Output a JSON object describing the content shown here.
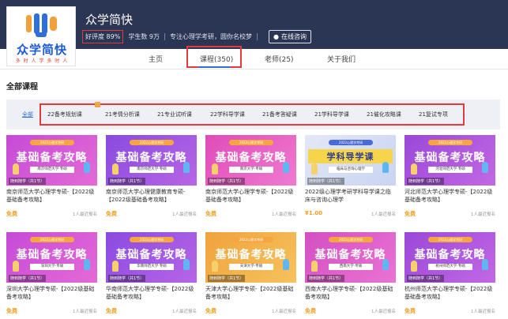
{
  "shop": {
    "name": "众学简快",
    "logo_text": "众学简快",
    "logo_sub": "多 时 人 学 多 时 人",
    "rating": "好评度 89%",
    "students": "学生数 9万",
    "tagline": "专注心理学考研，圆你名校梦",
    "follow_label": "在线咨询"
  },
  "nav": {
    "items": [
      "主页",
      "课程(350)",
      "老师(25)",
      "关于我们"
    ]
  },
  "section_title": "全部课程",
  "filter": {
    "all_label": "全部",
    "categories": [
      "22备考规划课",
      "21考情分析课",
      "21专业试听课",
      "22学科导学课",
      "21备考答疑课",
      "21学科导学课",
      "21催化攻略课",
      "21复试专项"
    ]
  },
  "cards": [
    {
      "pill": "2022心理学考研",
      "big": "基础备考攻略",
      "sub": "南京师范大学·专硕",
      "teacher": "随到随学（共1节）",
      "title": "南京师范大学心理学专硕-【2022级基础备考攻略】",
      "price": "免费",
      "enroll": "1人最近报名",
      "colors": {
        "bg": "#c54bd8",
        "bg2": "#e56ad6"
      }
    },
    {
      "pill": "2022心理学考研",
      "big": "基础备考攻略",
      "sub": "南京师范大学·专硕",
      "teacher": "随到随学（共1节）",
      "title": "南京师范大学心理健康教育专硕-【2022级基础备考攻略】",
      "price": "免费",
      "enroll": "1人最近报名",
      "colors": {
        "bg": "#8a4ae0",
        "bg2": "#b766e6"
      }
    },
    {
      "pill": "2022心理学考研",
      "big": "基础备考攻略",
      "sub": "南京大学·专硕",
      "teacher": "随到随学（共1节）",
      "title": "南京师范大学心理学专硕-【2022级基础备考攻略】",
      "price": "免费",
      "enroll": "1人最近报名",
      "colors": {
        "bg": "#e04bb9",
        "bg2": "#f07ad0"
      }
    },
    {
      "pill": "2022心理学考研",
      "big": "学科导学课",
      "sub": "临床与咨询心理学",
      "teacher": "随到随学（共1节）",
      "title": "2022级心理学考研学科导学课之临床与咨询心理学",
      "price": "¥1.00",
      "enroll": "1人最近报名",
      "colors": {
        "bg": "#e3e8f6",
        "bg2": "#c9d4f2"
      }
    },
    {
      "pill": "2022心理学考研",
      "big": "基础备考攻略",
      "sub": "河北师范大学·专硕",
      "teacher": "随到随学（共1节）",
      "title": "河北师范大学心理学专硕-【2022级基础备考攻略】",
      "price": "免费",
      "enroll": "1人最近报名",
      "colors": {
        "bg": "#9b48d8",
        "bg2": "#c168e4"
      }
    },
    {
      "pill": "2022心理学考研",
      "big": "基础备考攻略",
      "sub": "深圳大学·专硕",
      "teacher": "随到随学（共1节）",
      "title": "深圳大学心理学专硕-【2022级基础备考攻略】",
      "price": "免费",
      "enroll": "1人最近报名",
      "colors": {
        "bg": "#c54bd8",
        "bg2": "#e56ad6"
      }
    },
    {
      "pill": "2022心理学考研",
      "big": "基础备考攻略",
      "sub": "华南师范大学·专硕",
      "teacher": "随到随学（共1节）",
      "title": "华南师范大学心理学专硕-【2022级基础备考攻略】",
      "price": "免费",
      "enroll": "1人最近报名",
      "colors": {
        "bg": "#8a4ae0",
        "bg2": "#b766e6"
      }
    },
    {
      "pill": "2022心理学考研",
      "big": "基础备考攻略",
      "sub": "天津大学·专硕",
      "teacher": "随到随学（共1节）",
      "title": "天津大学心理学专硕-【2022级基础备考攻略】",
      "price": "免费",
      "enroll": "1人最近报名",
      "colors": {
        "bg": "#f0a33c",
        "bg2": "#f6c25e"
      }
    },
    {
      "pill": "2022心理学考研",
      "big": "基础备考攻略",
      "sub": "西南大学·专硕",
      "teacher": "随到随学（共1节）",
      "title": "西南大学心理学专硕-【2022级基础备考攻略】",
      "price": "免费",
      "enroll": "1人最近报名",
      "colors": {
        "bg": "#d34fc2",
        "bg2": "#ea73d4"
      }
    },
    {
      "pill": "2022心理学考研",
      "big": "基础备考攻略",
      "sub": "杭州师范大学·专硕",
      "teacher": "随到随学（共1节）",
      "title": "杭州师范大学心理学专硕-【2022级基础备考攻略】",
      "price": "免费",
      "enroll": "1人最近报名",
      "colors": {
        "bg": "#9b48d8",
        "bg2": "#c168e4"
      }
    }
  ]
}
